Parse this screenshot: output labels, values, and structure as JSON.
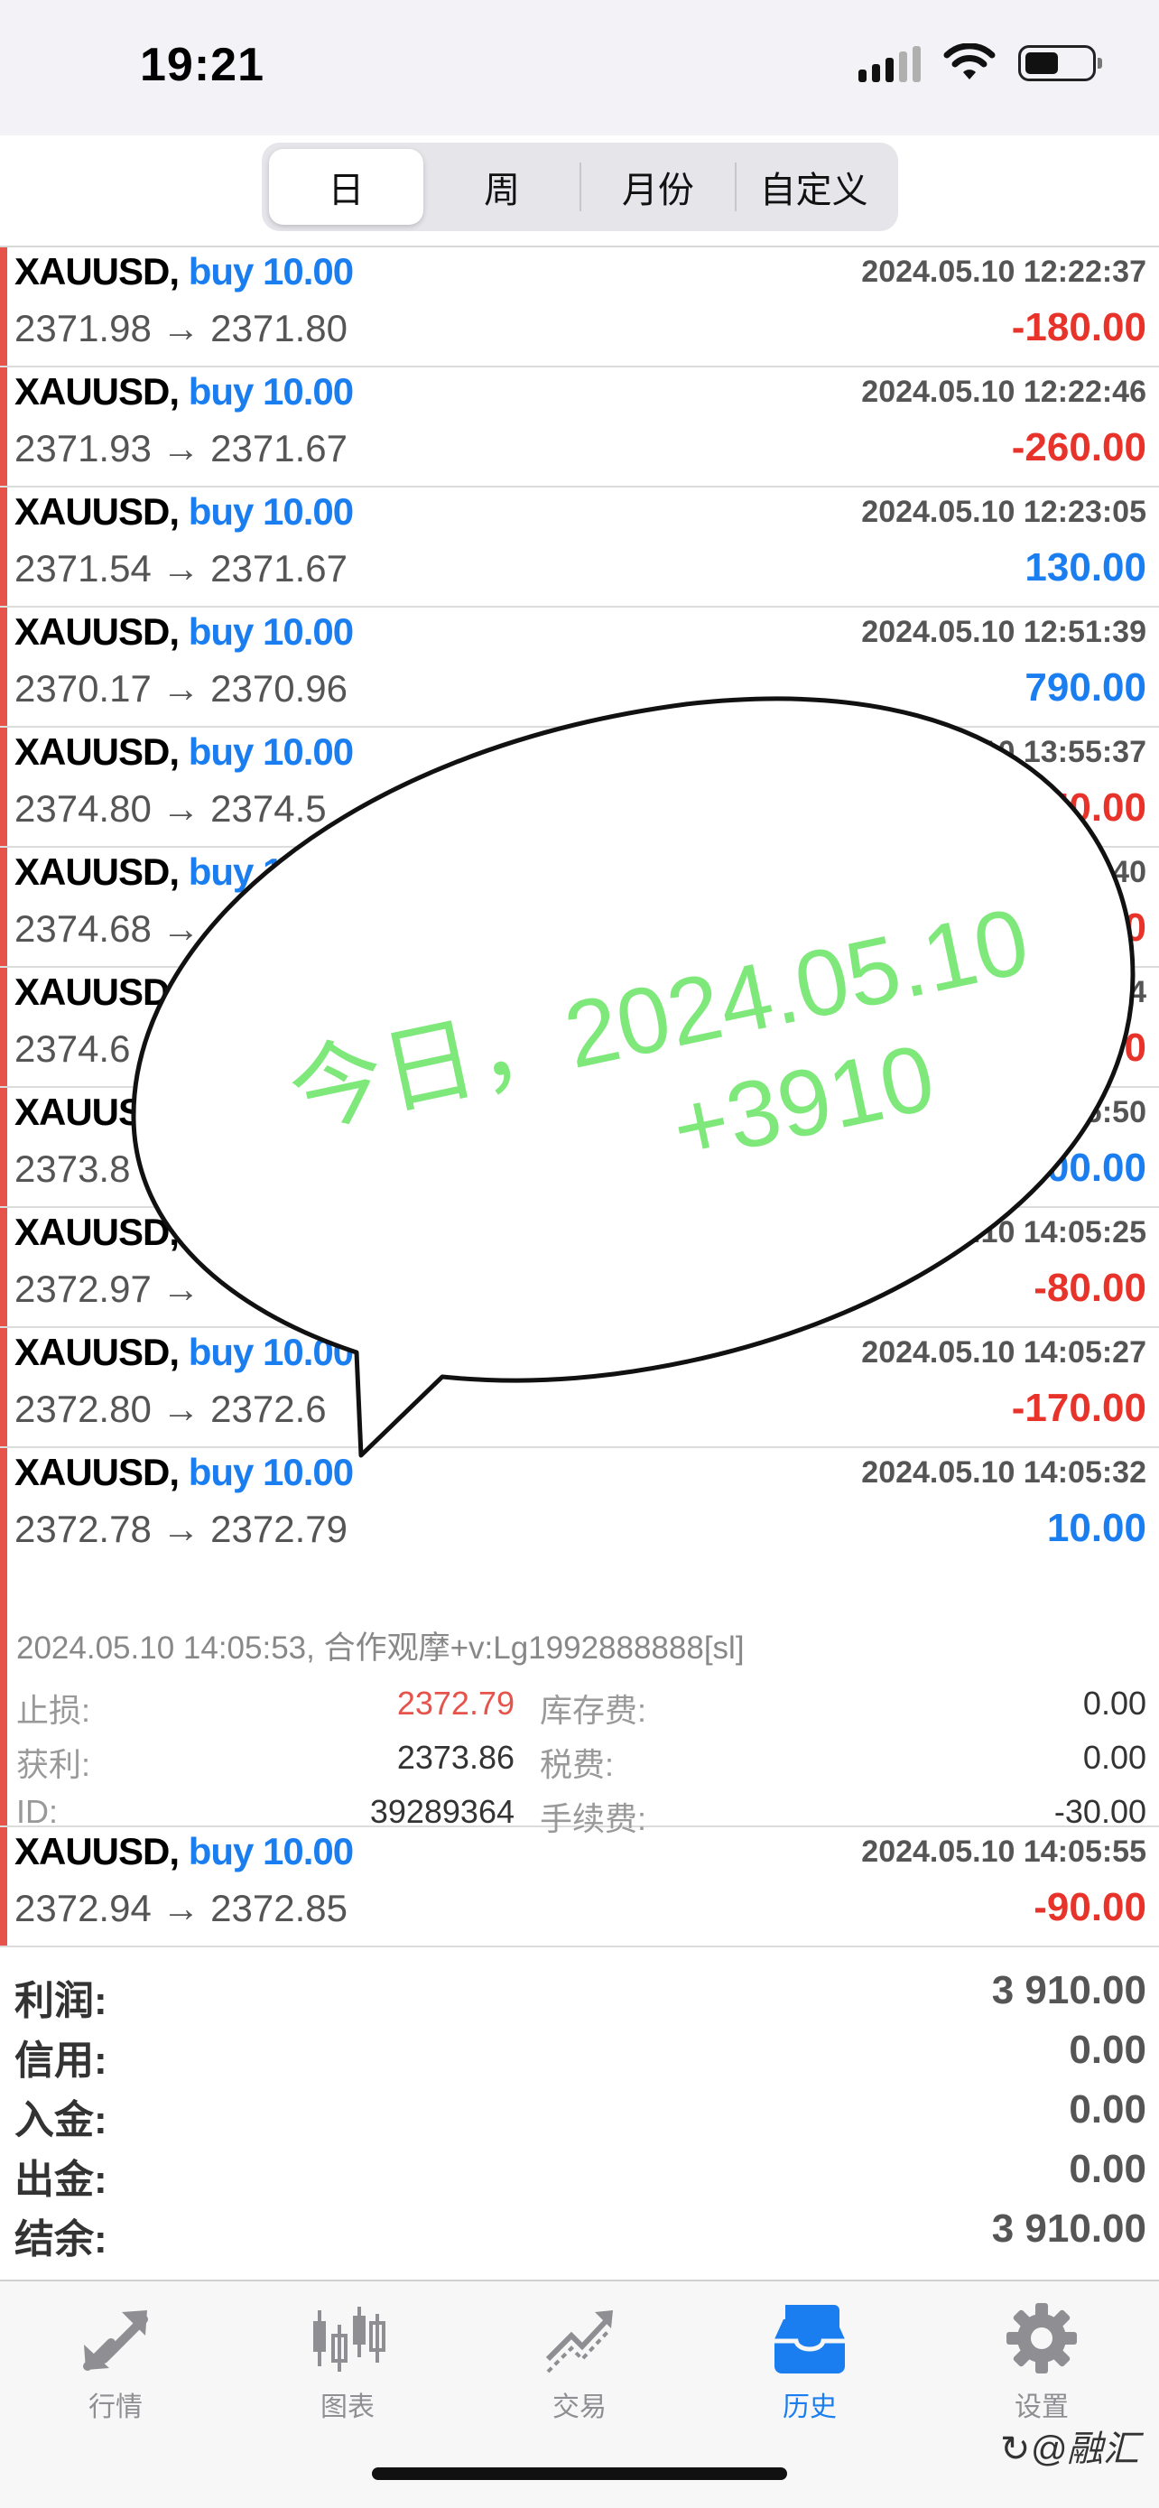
{
  "status_bar": {
    "time": "19:21"
  },
  "period_tabs": [
    {
      "label": "日",
      "active": true
    },
    {
      "label": "周",
      "active": false
    },
    {
      "label": "月份",
      "active": false
    },
    {
      "label": "自定义",
      "active": false
    }
  ],
  "trades": [
    {
      "symbol": "XAUUSD,",
      "direction": "buy 10.00",
      "time": "2024.05.10 12:22:37",
      "prices": "2371.98 → 2371.80",
      "profit": "-180.00"
    },
    {
      "symbol": "XAUUSD,",
      "direction": "buy 10.00",
      "time": "2024.05.10 12:22:46",
      "prices": "2371.93 → 2371.67",
      "profit": "-260.00"
    },
    {
      "symbol": "XAUUSD,",
      "direction": "buy 10.00",
      "time": "2024.05.10 12:23:05",
      "prices": "2371.54 → 2371.67",
      "profit": "130.00"
    },
    {
      "symbol": "XAUUSD,",
      "direction": "buy 10.00",
      "time": "2024.05.10 12:51:39",
      "prices": "2370.17 → 2370.96",
      "profit": "790.00"
    },
    {
      "symbol": "XAUUSD,",
      "direction": "buy 10.00",
      "time": "2024.05.10 13:55:37",
      "prices": "2374.80 → 2374.5",
      "profit": "50.00"
    },
    {
      "symbol": "XAUUSD,",
      "direction": "buy 1",
      "time": "40",
      "prices": "2374.68 →",
      "profit": "0"
    },
    {
      "symbol": "XAUUSD",
      "direction": "",
      "time": "4",
      "prices": "2374.6",
      "profit": "0"
    },
    {
      "symbol": "XAUUS",
      "direction": "",
      "time": "6:50",
      "prices": "2373.8",
      "profit": "600.00"
    },
    {
      "symbol": "XAUUSD,",
      "direction": "",
      "time": "5.10 14:05:25",
      "prices": "2372.97 →",
      "profit": "-80.00"
    },
    {
      "symbol": "XAUUSD,",
      "direction": "buy 10.00",
      "time": "2024.05.10 14:05:27",
      "prices": "2372.80 → 2372.6",
      "profit": "-170.00"
    }
  ],
  "expanded_trade": {
    "symbol": "XAUUSD,",
    "direction": "buy 10.00",
    "time": "2024.05.10 14:05:32",
    "prices": "2372.78 → 2372.79",
    "profit": "10.00",
    "detail_line": "2024.05.10 14:05:53, 合作观摩+v:Lg1992888888[sl]",
    "stop_loss_label": "止损:",
    "stop_loss_value": "2372.79",
    "take_profit_label": "获利:",
    "take_profit_value": "2373.86",
    "id_label": "ID:",
    "id_value": "39289364",
    "swap_label": "库存费:",
    "swap_value": "0.00",
    "tax_label": "税费:",
    "tax_value": "0.00",
    "fee_label": "手续费:",
    "fee_value": "-30.00"
  },
  "last_trade": {
    "symbol": "XAUUSD,",
    "direction": "buy 10.00",
    "time": "2024.05.10 14:05:55",
    "prices": "2372.94 → 2372.85",
    "profit": "-90.00"
  },
  "summary": [
    {
      "label": "利润:",
      "value": "3 910.00"
    },
    {
      "label": "信用:",
      "value": "0.00"
    },
    {
      "label": "入金:",
      "value": "0.00"
    },
    {
      "label": "出金:",
      "value": "0.00"
    },
    {
      "label": "结余:",
      "value": "3 910.00"
    }
  ],
  "bubble": {
    "line1": "今日，2024.05.10",
    "line2": "+3910"
  },
  "tabbar": [
    {
      "label": "行情",
      "icon": "quotes-arrows-icon",
      "active": false
    },
    {
      "label": "图表",
      "icon": "candlestick-chart-icon",
      "active": false
    },
    {
      "label": "交易",
      "icon": "trade-trend-icon",
      "active": false
    },
    {
      "label": "历史",
      "icon": "history-inbox-icon",
      "active": true
    },
    {
      "label": "设置",
      "icon": "gear-icon",
      "active": false
    }
  ],
  "watermark": "↻@融汇",
  "colors": {
    "profit_positive": "#1a7ef0",
    "profit_negative": "#e8332a",
    "accent": "#1a7ef0",
    "bubble_text": "#7ee87a"
  }
}
